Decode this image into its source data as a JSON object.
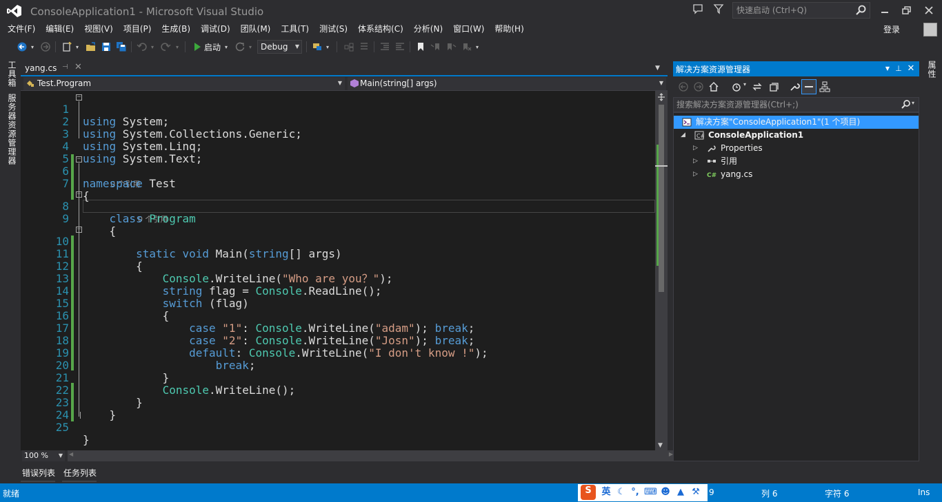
{
  "window": {
    "title": "ConsoleApplication1 - Microsoft Visual Studio",
    "quick_launch_placeholder": "快速启动 (Ctrl+Q)"
  },
  "menu": {
    "items": [
      "文件(F)",
      "编辑(E)",
      "视图(V)",
      "项目(P)",
      "生成(B)",
      "调试(D)",
      "团队(M)",
      "工具(T)",
      "测试(S)",
      "体系结构(C)",
      "分析(N)",
      "窗口(W)",
      "帮助(H)"
    ],
    "login": "登录"
  },
  "toolbar": {
    "start_label": "启动",
    "configuration": "Debug"
  },
  "side_tabs": {
    "left": [
      "工具箱",
      "服务器资源管理器"
    ],
    "right": [
      "属性"
    ]
  },
  "editor": {
    "tab_label": "yang.cs",
    "nav_class": "Test.Program",
    "nav_member": "Main(string[] args)",
    "zoom": "100 %",
    "ref_hint": "0 个引用",
    "line_numbers": [
      "1",
      "2",
      "3",
      "4",
      "5",
      "6",
      "7",
      "8",
      "9",
      "10",
      "11",
      "12",
      "13",
      "14",
      "15",
      "16",
      "17",
      "18",
      "19",
      "20",
      "21",
      "22",
      "23",
      "24",
      "25"
    ],
    "code": {
      "l1": [
        "using",
        " System;"
      ],
      "l2": [
        "using",
        " System.Collections.Generic;"
      ],
      "l3": [
        "using",
        " System.Linq;"
      ],
      "l4": [
        "using",
        " System.Text;"
      ],
      "l6": [
        "namespace",
        " Test"
      ],
      "l7": "{",
      "l8": [
        "class",
        "Program"
      ],
      "l9": "{",
      "l10": [
        "static",
        "void",
        " Main(",
        "string",
        "[] args)"
      ],
      "l11": "{",
      "l12": [
        "Console",
        ".WriteLine(",
        "\"Who are you？\"",
        ");"
      ],
      "l13": [
        "string",
        " flag = ",
        "Console",
        ".ReadLine();"
      ],
      "l14": [
        "switch",
        " (flag)"
      ],
      "l15": "{",
      "l16": [
        "case",
        "\"1\"",
        ": ",
        "Console",
        ".WriteLine(",
        "\"adam\"",
        "); ",
        "break",
        ";"
      ],
      "l17": [
        "case",
        "\"2\"",
        ": ",
        "Console",
        ".WriteLine(",
        "\"Josn\"",
        "); ",
        "break",
        ";"
      ],
      "l18": [
        "default",
        ": ",
        "Console",
        ".WriteLine(",
        "\"I don't know !\"",
        ");"
      ],
      "l19": [
        "break",
        ";"
      ],
      "l20": "}",
      "l21": [
        "Console",
        ".WriteLine();"
      ],
      "l22": "}",
      "l23": "}",
      "l25": "}"
    }
  },
  "bottom_tabs": [
    "错误列表",
    "任务列表"
  ],
  "solution_explorer": {
    "title": "解决方案资源管理器",
    "search_placeholder": "搜索解决方案资源管理器(Ctrl+;)",
    "tree": {
      "solution": "解决方案\"ConsoleApplication1\"(1 个项目)",
      "project": "ConsoleApplication1",
      "properties": "Properties",
      "references": "引用",
      "file": "yang.cs"
    }
  },
  "status": {
    "ready": "就绪",
    "line_partial": "9",
    "col": "列 6",
    "char": "字符 6",
    "mode": "Ins",
    "ime_lang": "英"
  },
  "colors": {
    "accent": "#007acc",
    "keyword": "#569cd6",
    "type": "#4ec9b0",
    "string": "#d69d85",
    "line_number": "#2b91af",
    "change_marker": "#57a64a"
  }
}
